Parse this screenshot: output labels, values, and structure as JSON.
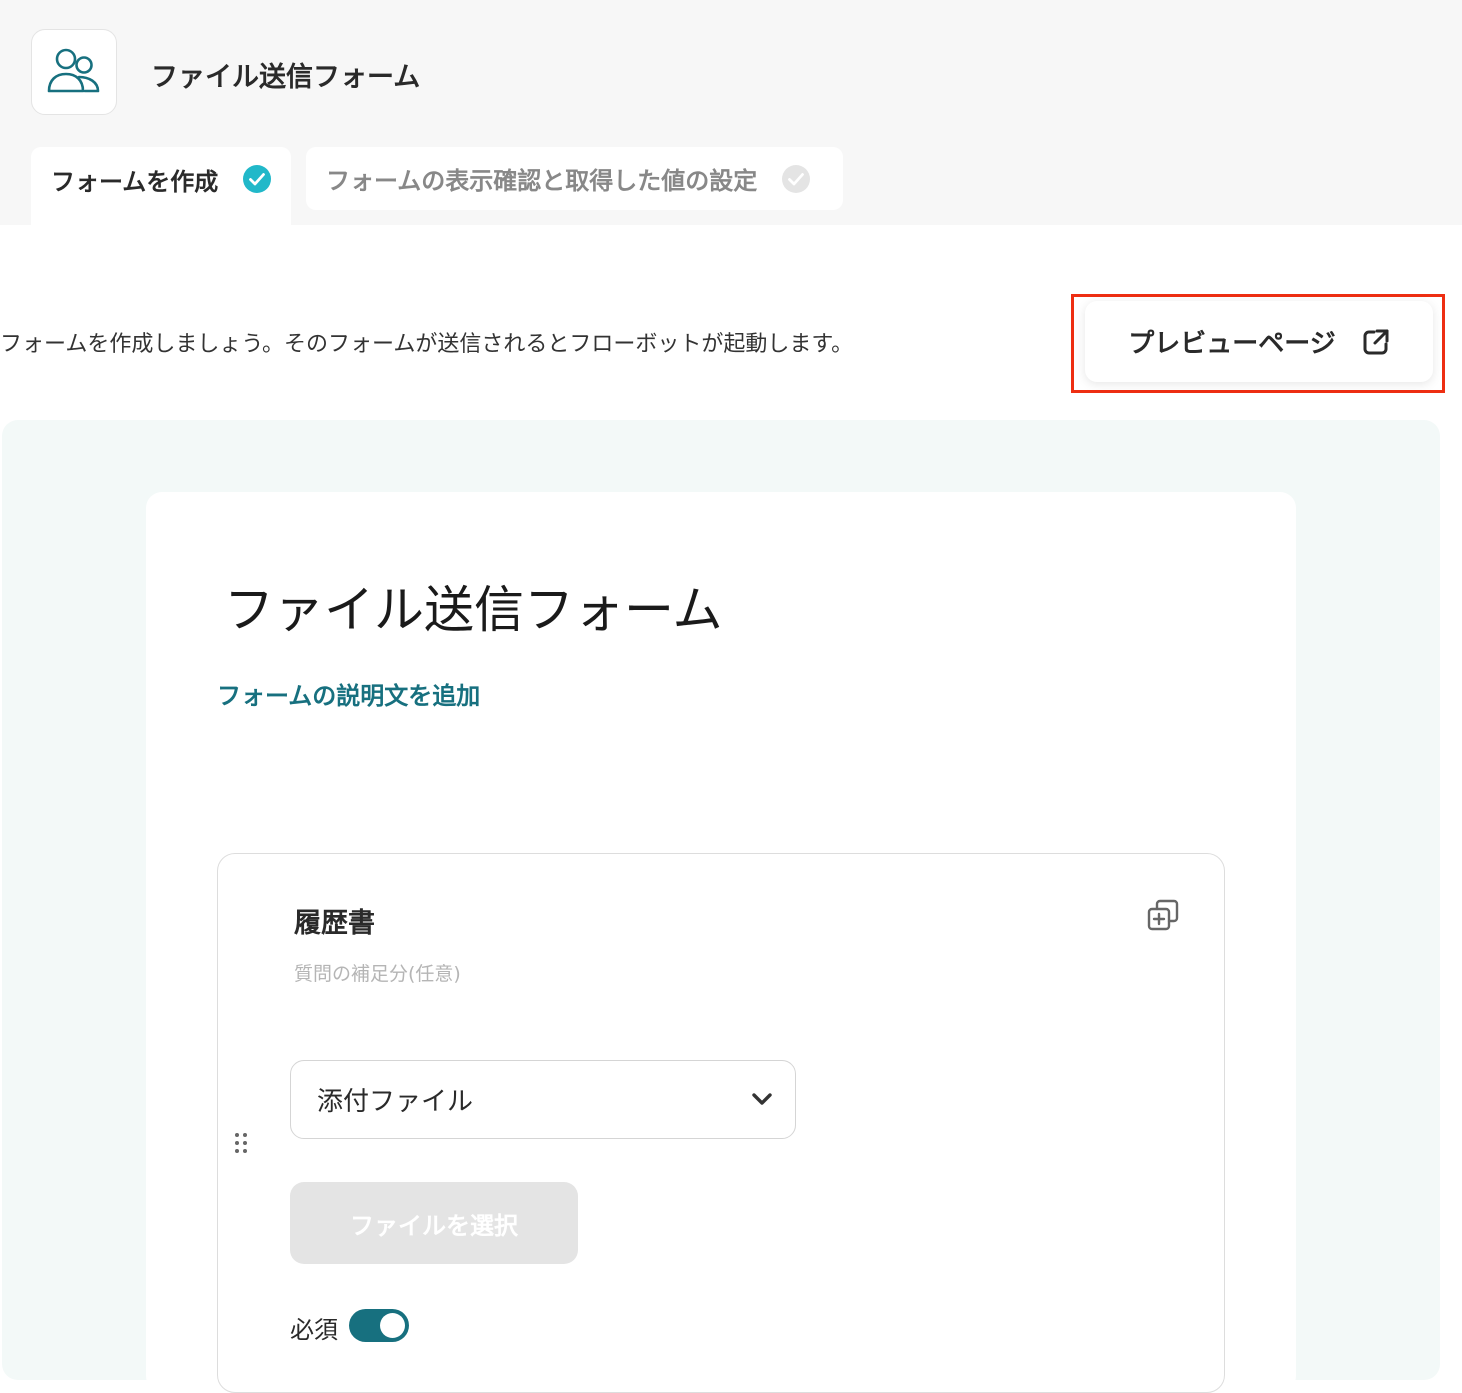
{
  "app": {
    "title": "ファイル送信フォーム",
    "icon": "users-icon"
  },
  "tabs": [
    {
      "label": "フォームを作成",
      "status": "complete",
      "active": true
    },
    {
      "label": "フォームの表示確認と取得した値の設定",
      "status": "incomplete",
      "active": false
    }
  ],
  "instruction": "フォームを作成しましょう。そのフォームが送信されるとフローボットが起動します。",
  "preview_button": {
    "label": "プレビューページ",
    "icon": "external-link-icon"
  },
  "form": {
    "title": "ファイル送信フォーム",
    "add_description_link": "フォームの説明文を追加",
    "questions": [
      {
        "title": "履歴書",
        "hint": "質問の補足分(任意)",
        "type": "添付ファイル",
        "file_button": "ファイルを選択",
        "required_label": "必須",
        "required": true
      }
    ]
  },
  "colors": {
    "accent": "#17707f",
    "check_active": "#21b8c9",
    "highlight": "#ee2e12",
    "form_background": "#f3f9f8"
  }
}
